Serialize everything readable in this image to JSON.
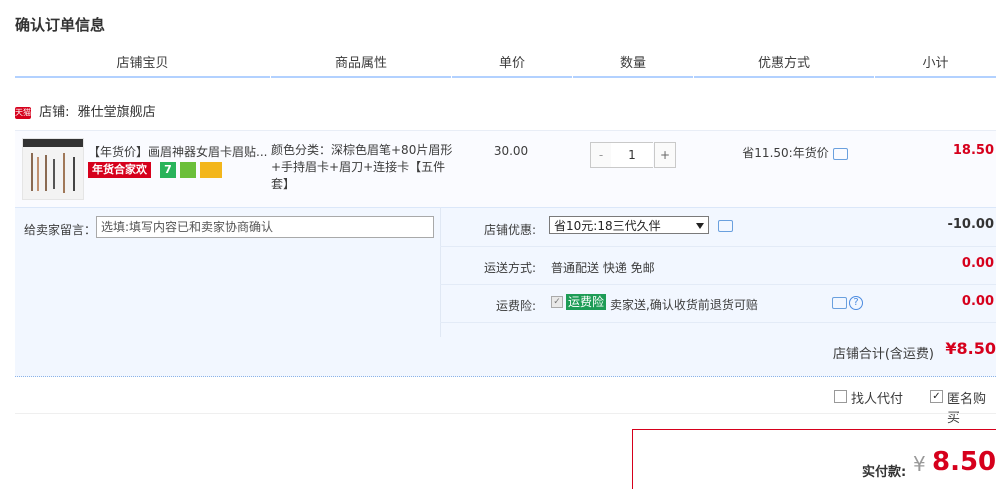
{
  "page": {
    "title": "确认订单信息"
  },
  "columns": [
    "店铺宝贝",
    "商品属性",
    "单价",
    "数量",
    "优惠方式",
    "小计"
  ],
  "shop": {
    "badge": "天猫",
    "label": "店铺:",
    "name": "雅仕堂旗舰店"
  },
  "item": {
    "name": "【年货价】画眉神器女眉卡眉贴...",
    "promo_badge": "年货合家欢",
    "seven_badge": "7",
    "attributes": "颜色分类：深棕色眉笔+80片眉形+手持眉卡+眉刀+连接卡【五件套】",
    "unit_price": "30.00",
    "quantity": "1",
    "qty_minus": "-",
    "qty_plus": "+",
    "discount": "省11.50:年货价",
    "subtotal": "18.50"
  },
  "message": {
    "label": "给卖家留言：",
    "placeholder": "选填:填写内容已和卖家协商确认"
  },
  "shop_discount": {
    "label": "店铺优惠:",
    "selected": "省10元:18三代久伴",
    "value": "-10.00"
  },
  "shipping": {
    "label": "运送方式:",
    "text": "普通配送 快递 免邮",
    "value": "0.00"
  },
  "insurance": {
    "label": "运费险:",
    "badge": "运费险",
    "text": "卖家送,确认收货前退货可赔",
    "value": "0.00",
    "help": "?"
  },
  "shop_total": {
    "label": "店铺合计(含运费)",
    "value": "¥8.50"
  },
  "options": {
    "proxy_pay": "找人代付",
    "proxy_checked": false,
    "anonymous": "匿名购买",
    "anonymous_checked": true
  },
  "payment": {
    "label": "实付款:",
    "currency": "¥",
    "amount": "8.50"
  },
  "colors": {
    "accent_red": "#d6001c",
    "header_line": "#b2d1ff",
    "panel_bg": "#f2f7ff",
    "insurance_green": "#1e9c56"
  }
}
